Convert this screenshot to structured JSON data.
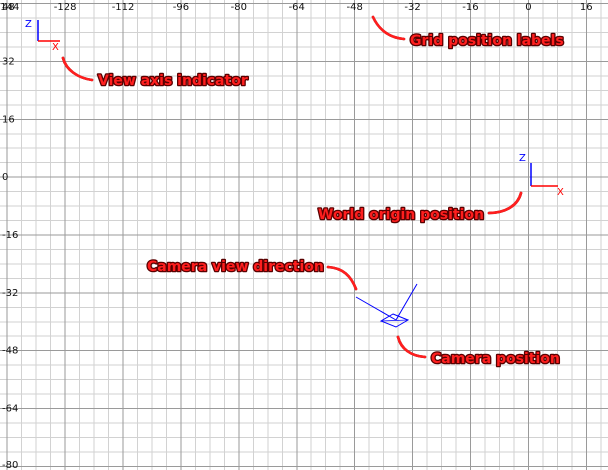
{
  "viewport": {
    "name": "top-view-grid",
    "grid_step_units": 4,
    "major_step_units": 16,
    "x_range": [
      -146,
      22
    ],
    "z_range": [
      -81,
      49
    ],
    "x_labels": [
      "-144",
      "-128",
      "-112",
      "-96",
      "-80",
      "-64",
      "-48",
      "-32",
      "-16",
      "0",
      "16"
    ],
    "z_labels": [
      "48",
      "32",
      "16",
      "0",
      "-16",
      "-32",
      "-48",
      "-64",
      "-80"
    ],
    "colors": {
      "background": "#ffffff",
      "grid_minor": "#d2d2d2",
      "grid_major": "#9a9a9a",
      "axis_x": "#ff0000",
      "axis_z": "#0000ff",
      "camera": "#0000ff",
      "callout_text": "#ff1e1e",
      "callout_outline": "#5a0000"
    }
  },
  "view_axis_indicator": {
    "x_label": "X",
    "z_label": "Z"
  },
  "world_origin_gizmo": {
    "x_label": "X",
    "z_label": "Z",
    "position": [
      0,
      0
    ]
  },
  "camera": {
    "position": [
      -36,
      -38
    ],
    "view_direction": "toward -X and +Z"
  },
  "callouts": {
    "grid_labels": "Grid position labels",
    "view_axis": "View axis indicator",
    "world_origin": "World origin position",
    "camera_direction": "Camera view direction",
    "camera_position": "Camera position"
  }
}
